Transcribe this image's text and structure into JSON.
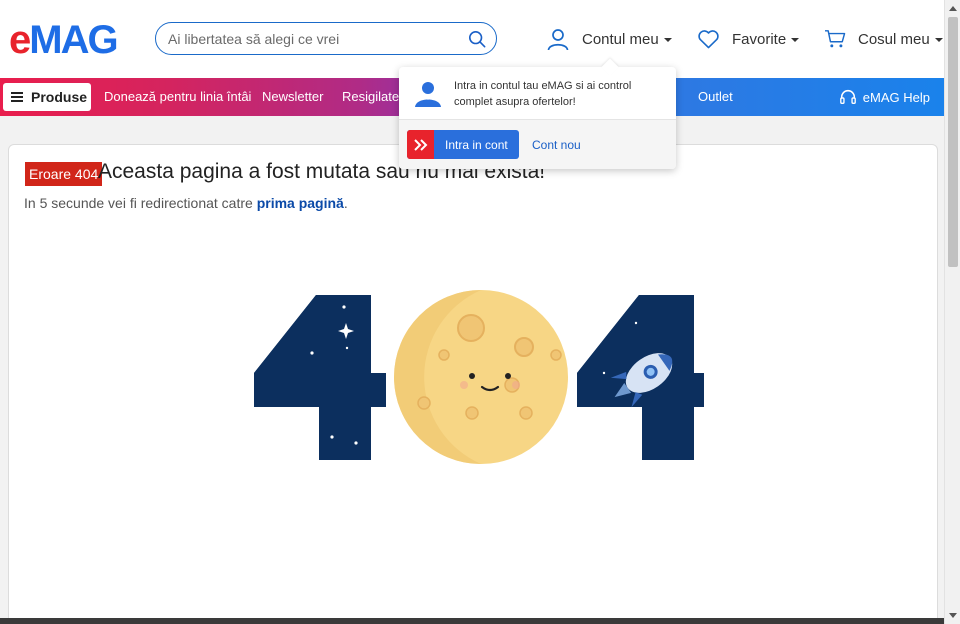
{
  "header": {
    "logo": {
      "e": "e",
      "mag": "MAG"
    },
    "search_placeholder": "Ai libertatea să alegi ce vrei",
    "account_label": "Contul meu",
    "favorites_label": "Favorite",
    "cart_label": "Cosul meu"
  },
  "nav": {
    "produse_label": "Produse",
    "items": [
      "Donează pentru linia întâi",
      "Newsletter",
      "Resigilate",
      "Outlet"
    ],
    "help_label": "eMAG Help"
  },
  "popover": {
    "message": "Intra in contul tau eMAG si ai control complet asupra ofertelor!",
    "login_label": "Intra in cont",
    "new_account_label": "Cont nou"
  },
  "error": {
    "badge": "Eroare 404",
    "title": "Aceasta pagina a fost mutata sau nu mai exista!",
    "redirect_prefix": "In 5 secunde vei fi redirectionat catre ",
    "redirect_link": "prima pagină",
    "redirect_suffix": "."
  },
  "colors": {
    "brand_red": "#e8232c",
    "brand_blue": "#1e6de6",
    "error_red": "#d12619",
    "link_blue": "#0b4aa8"
  },
  "icons": [
    "search-icon",
    "user-icon",
    "heart-icon",
    "cart-icon",
    "menu-icon",
    "headset-icon",
    "double-chevron-icon"
  ]
}
